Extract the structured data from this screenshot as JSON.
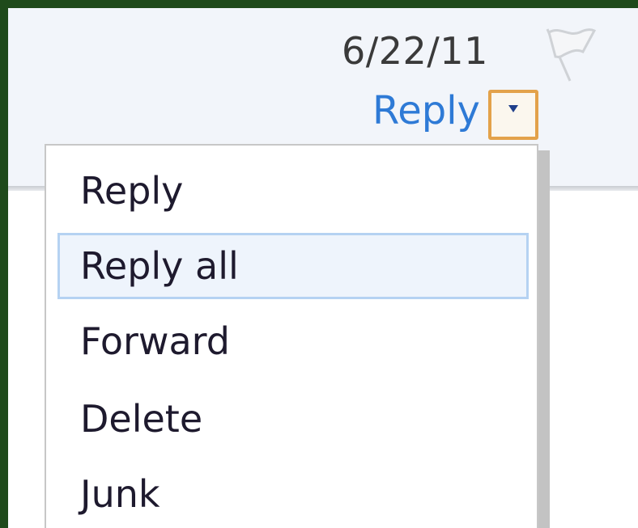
{
  "message_header": {
    "date": "6/22/11",
    "reply_label": "Reply",
    "flag_icon": "flag-icon",
    "dropdown_icon": "chevron-down-icon"
  },
  "reply_menu": {
    "items": [
      {
        "label": "Reply",
        "selected": false
      },
      {
        "label": "Reply all",
        "selected": true
      },
      {
        "label": "Forward",
        "selected": false
      },
      {
        "label": "Delete",
        "selected": false
      },
      {
        "label": "Junk",
        "selected": false
      }
    ]
  },
  "colors": {
    "link": "#2e7ad6",
    "dropdown_border": "#e3a24a",
    "selection_border": "#b5d2f2",
    "window_border": "#1f4a1b"
  }
}
